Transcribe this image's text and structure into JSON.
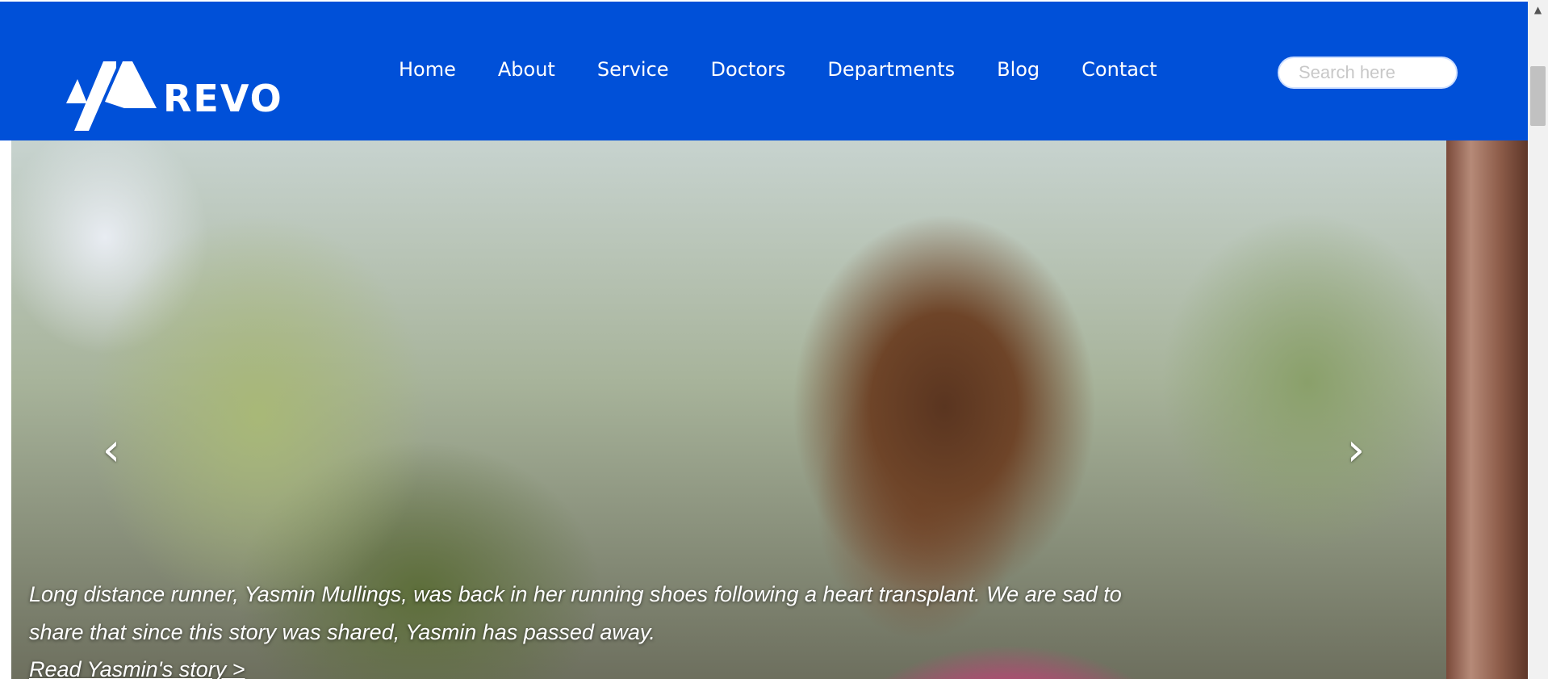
{
  "header": {
    "logo_text": "REVO",
    "nav": [
      {
        "label": "Home"
      },
      {
        "label": "About"
      },
      {
        "label": "Service"
      },
      {
        "label": "Doctors"
      },
      {
        "label": "Departments"
      },
      {
        "label": "Blog"
      },
      {
        "label": "Contact"
      }
    ],
    "search": {
      "placeholder": "Search here",
      "value": ""
    }
  },
  "hero": {
    "caption": "Long distance runner, Yasmin Mullings, was back in her running shoes following a heart transplant. We are sad to share that since this story was shared, Yasmin has passed away.",
    "link_text": "Read Yasmin's story >",
    "prev_icon": "chevron-left-icon",
    "next_icon": "chevron-right-icon"
  },
  "scrollbar": {
    "up_icon": "triangle-up-icon"
  },
  "colors": {
    "brand": "#0050d8",
    "text_on_brand": "#ffffff"
  }
}
